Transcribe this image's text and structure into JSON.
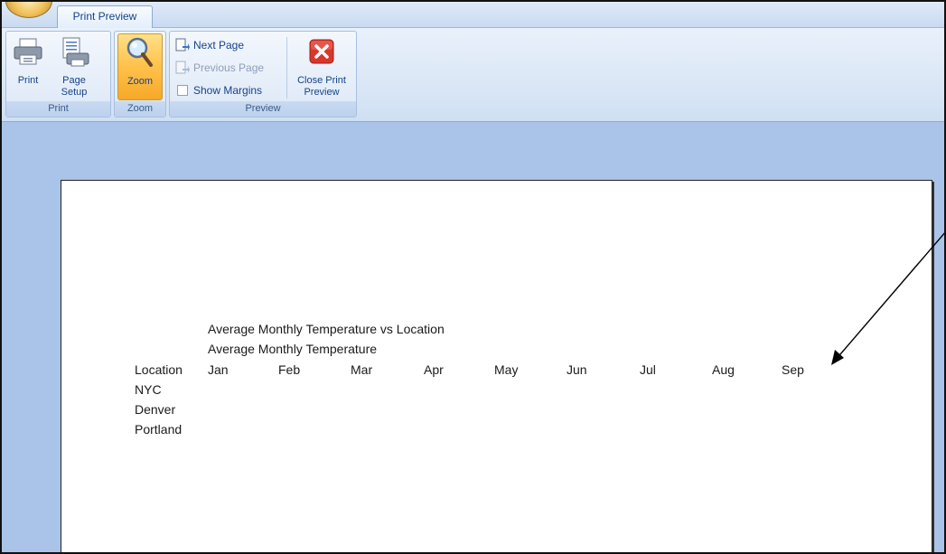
{
  "tabs": {
    "active_tab": "Print Preview"
  },
  "ribbon": {
    "groups": {
      "print": {
        "label": "Print",
        "print_btn": "Print",
        "page_setup_btn": "Page\nSetup"
      },
      "zoom": {
        "label": "Zoom",
        "zoom_btn": "Zoom"
      },
      "preview": {
        "label": "Preview",
        "next_page": "Next Page",
        "previous_page": "Previous Page",
        "show_margins": "Show Margins",
        "close_preview": "Close Print\nPreview"
      }
    },
    "icons": {
      "print": "printer-icon",
      "page_setup": "page-setup-icon",
      "zoom": "magnifier-icon",
      "next_page": "next-page-icon",
      "previous_page": "previous-page-icon",
      "close": "close-red-x-icon"
    },
    "colors": {
      "zoom_active": "#ffc44f",
      "close_red": "#d9372b"
    }
  },
  "sheet": {
    "title_line1": "Average Monthly Temperature vs Location",
    "title_line2": "Average Monthly Temperature",
    "header_location": "Location",
    "months": [
      "Jan",
      "Feb",
      "Mar",
      "Apr",
      "May",
      "Jun",
      "Jul",
      "Aug",
      "Sep"
    ],
    "locations": [
      "NYC",
      "Denver",
      "Portland"
    ]
  }
}
